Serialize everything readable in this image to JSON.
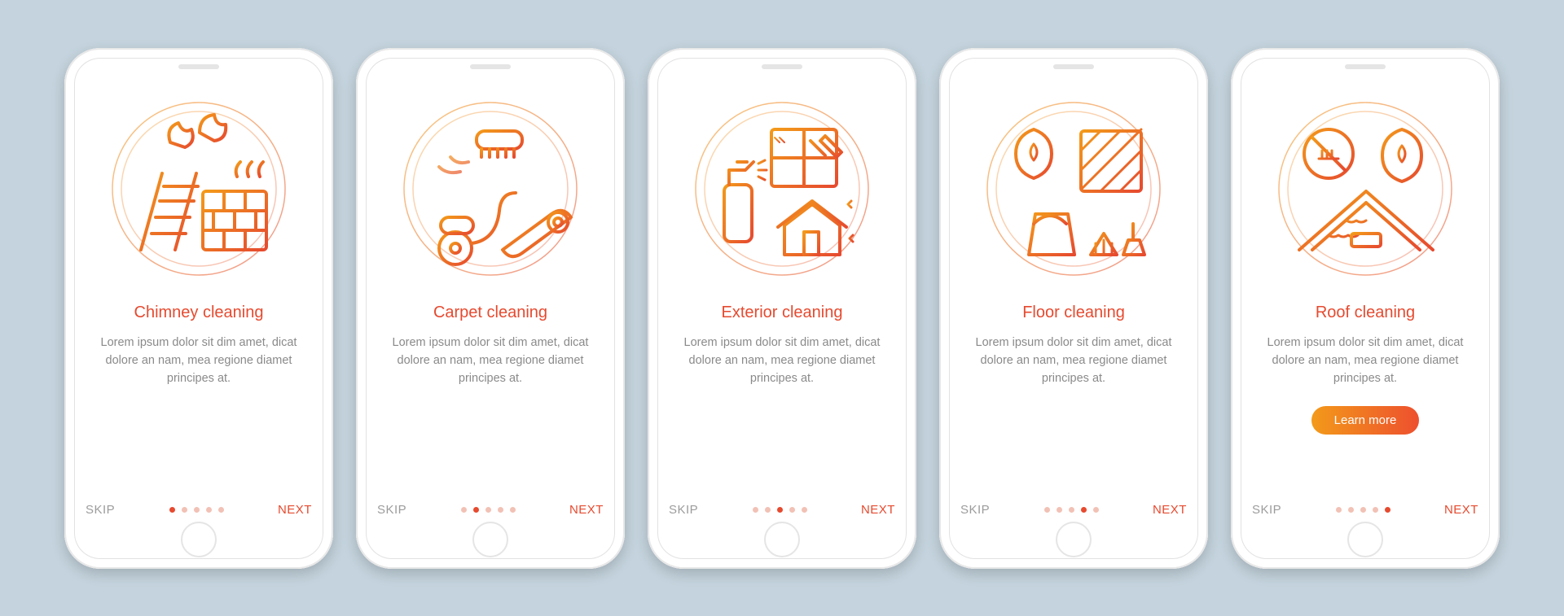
{
  "common": {
    "skip_label": "SKIP",
    "next_label": "NEXT",
    "cta_label": "Learn more",
    "body_text": "Lorem ipsum dolor sit dim amet, dicat dolore an nam, mea regione diamet principes at.",
    "total_steps": 5
  },
  "screens": [
    {
      "title": "Chimney cleaning",
      "icon": "chimney-cleaning-icon",
      "active_index": 0,
      "has_cta": false
    },
    {
      "title": "Carpet cleaning",
      "icon": "carpet-cleaning-icon",
      "active_index": 1,
      "has_cta": false
    },
    {
      "title": "Exterior cleaning",
      "icon": "exterior-cleaning-icon",
      "active_index": 2,
      "has_cta": false
    },
    {
      "title": "Floor cleaning",
      "icon": "floor-cleaning-icon",
      "active_index": 3,
      "has_cta": false
    },
    {
      "title": "Roof cleaning",
      "icon": "roof-cleaning-icon",
      "active_index": 4,
      "has_cta": true
    }
  ],
  "colors": {
    "accent_start": "#f39a1a",
    "accent_end": "#ed502e",
    "background": "#c4d3dd"
  }
}
